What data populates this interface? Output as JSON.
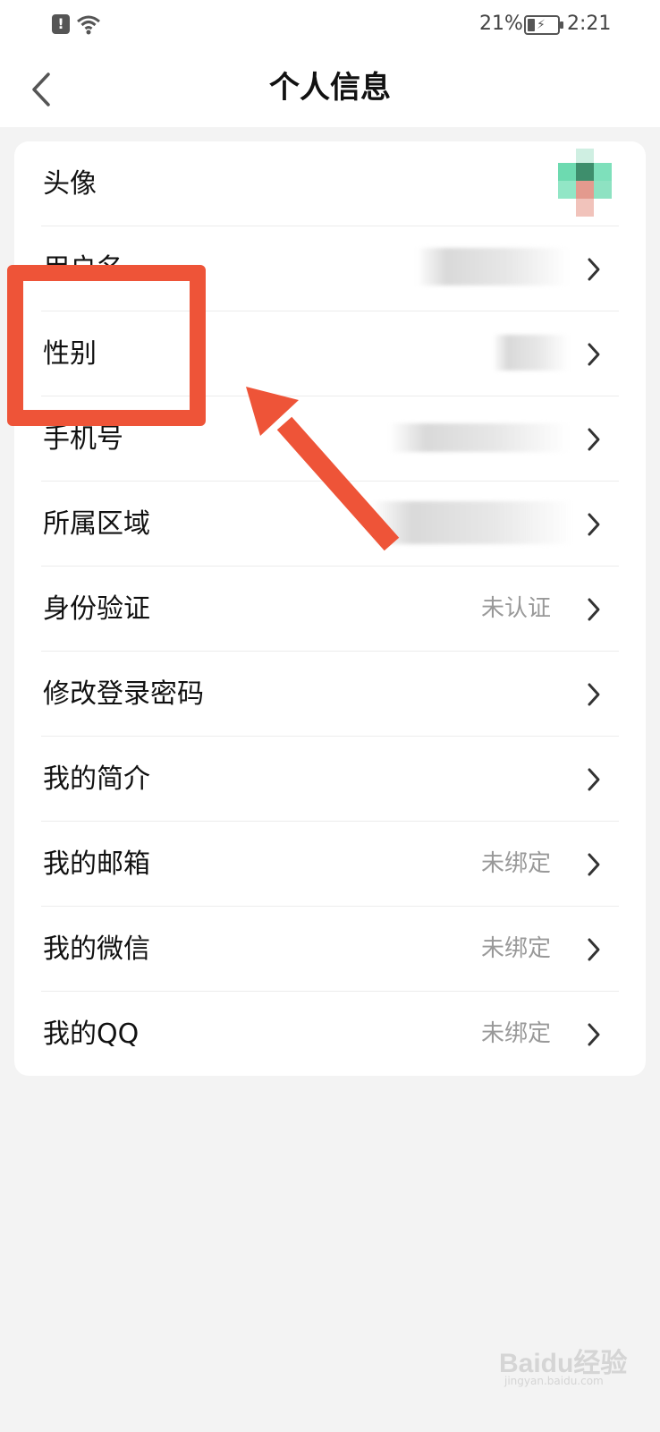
{
  "status_bar": {
    "battery": "21%",
    "time": "2:21"
  },
  "header": {
    "title": "个人信息"
  },
  "rows": [
    {
      "label": "头像",
      "value": ""
    },
    {
      "label": "用户名",
      "value": ""
    },
    {
      "label": "性别",
      "value": ""
    },
    {
      "label": "手机号",
      "value": ""
    },
    {
      "label": "所属区域",
      "value": ""
    },
    {
      "label": "身份验证",
      "value": "未认证"
    },
    {
      "label": "修改登录密码",
      "value": ""
    },
    {
      "label": "我的简介",
      "value": ""
    },
    {
      "label": "我的邮箱",
      "value": "未绑定"
    },
    {
      "label": "我的微信",
      "value": "未绑定"
    },
    {
      "label": "我的QQ",
      "value": "未绑定"
    }
  ],
  "annotation": {
    "color": "#ee5438"
  },
  "watermark": {
    "brand": "Baidu经验",
    "url": "jingyan.baidu.com"
  }
}
